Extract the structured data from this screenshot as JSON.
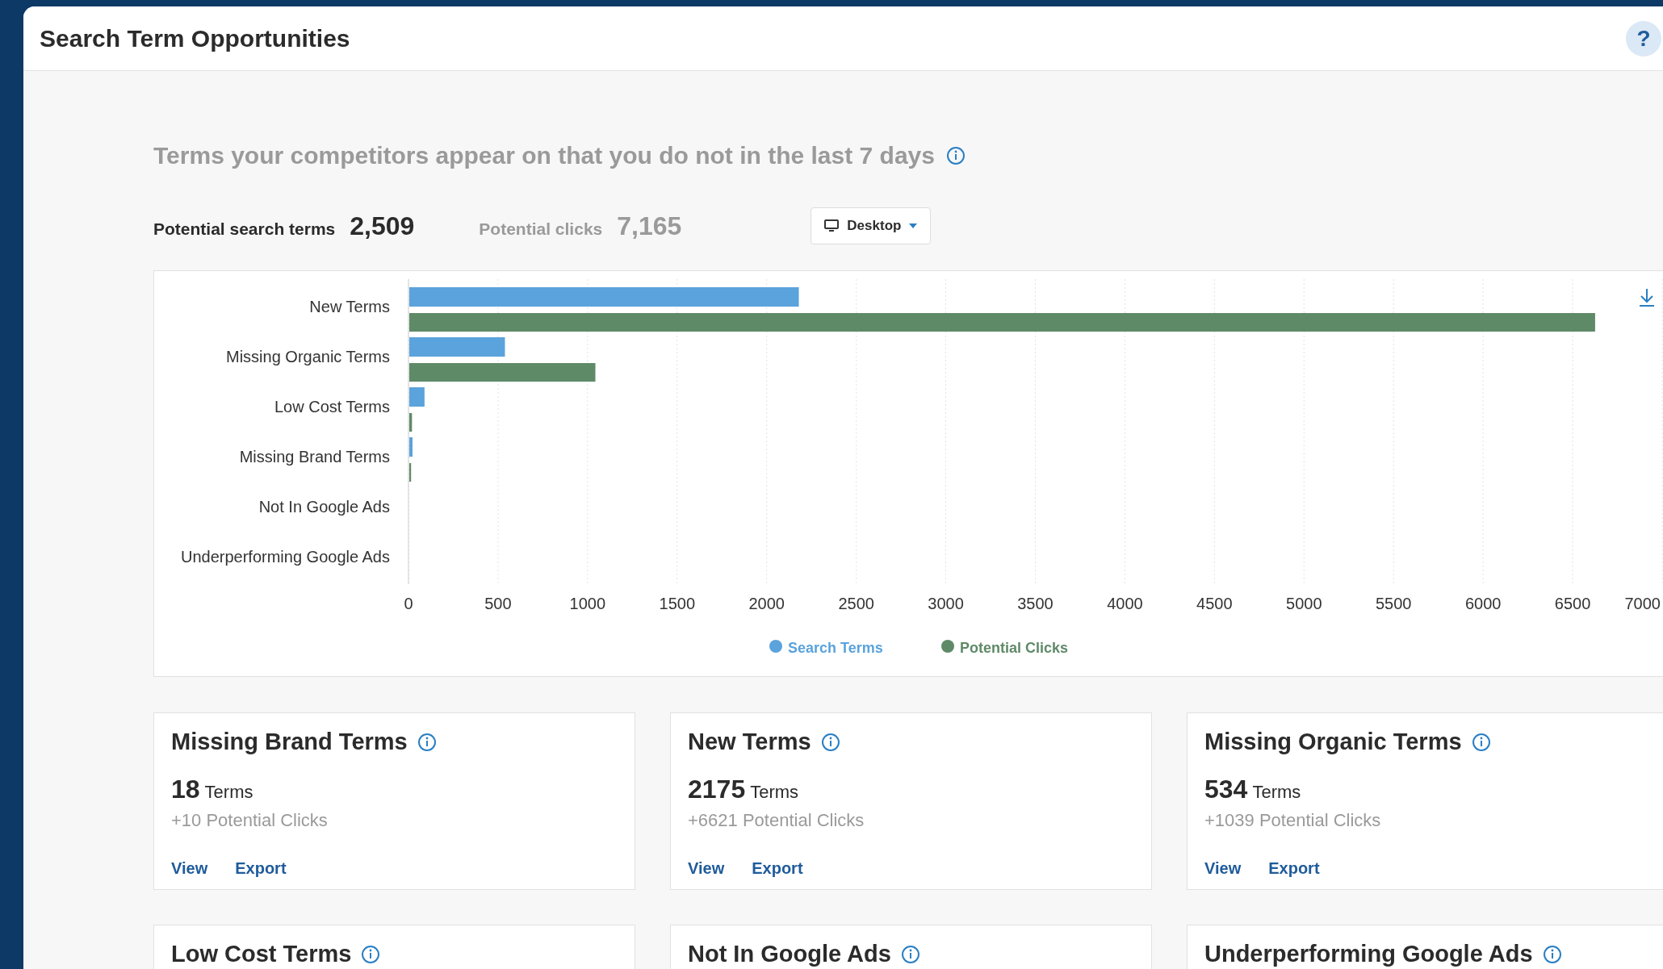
{
  "header": {
    "title": "Search Term Opportunities",
    "help": "?"
  },
  "subtitle": "Terms your competitors appear on that you do not in the last 7 days",
  "stats": [
    {
      "label": "Potential search terms",
      "value": "2,509",
      "kind": "primary"
    },
    {
      "label": "Potential clicks",
      "value": "7,165",
      "kind": "secondary"
    }
  ],
  "device_dropdown": {
    "value": "Desktop"
  },
  "chart": {
    "chart_data": {
      "type": "bar",
      "orientation": "horizontal",
      "categories": [
        "New Terms",
        "Missing Organic Terms",
        "Low Cost Terms",
        "Missing Brand Terms",
        "Not In Google Ads",
        "Underperforming Google Ads"
      ],
      "series": [
        {
          "name": "Search Terms",
          "color": "#5ba3dc",
          "values": [
            2175,
            534,
            85,
            18,
            0,
            0
          ]
        },
        {
          "name": "Potential Clicks",
          "color": "#5f8a68",
          "values": [
            6621,
            1039,
            15,
            10,
            0,
            0
          ]
        }
      ],
      "xlim": [
        0,
        7000
      ],
      "grid": true,
      "legend": true,
      "xticks": [
        0,
        500,
        1000,
        1500,
        2000,
        2500,
        3000,
        3500,
        4000,
        4500,
        5000,
        5500,
        6000,
        6500,
        7000
      ]
    }
  },
  "cards": [
    {
      "title": "Missing Brand Terms",
      "count": "18",
      "unit": "Terms",
      "clicks": "+10 Potential Clicks",
      "actions": [
        "View",
        "Export"
      ]
    },
    {
      "title": "New Terms",
      "count": "2175",
      "unit": "Terms",
      "clicks": "+6621 Potential Clicks",
      "actions": [
        "View",
        "Export"
      ]
    },
    {
      "title": "Missing Organic Terms",
      "count": "534",
      "unit": "Terms",
      "clicks": "+1039 Potential Clicks",
      "actions": [
        "View",
        "Export"
      ]
    },
    {
      "title": "Low Cost Terms"
    },
    {
      "title": "Not In Google Ads"
    },
    {
      "title": "Underperforming Google Ads"
    }
  ]
}
